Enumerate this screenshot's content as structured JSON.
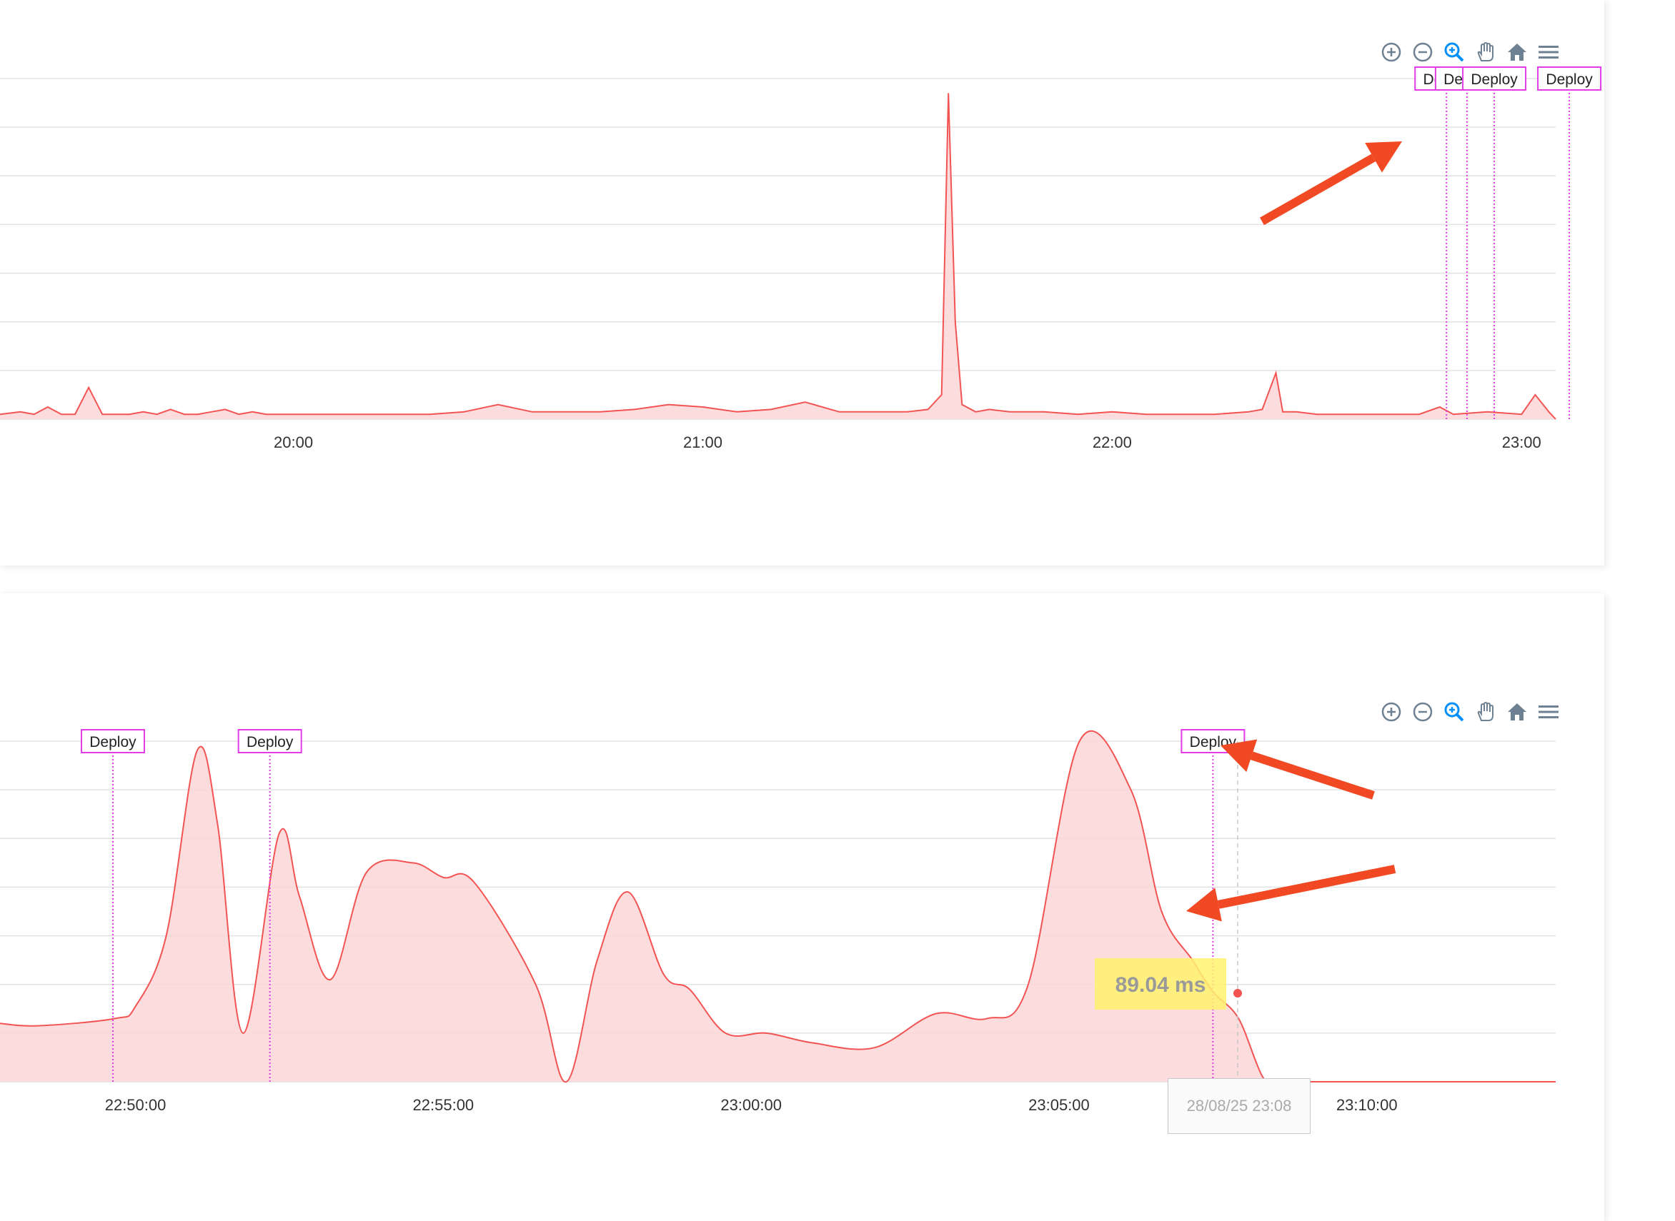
{
  "colors": {
    "series": "#f25454",
    "fill": "#fcd6d6",
    "annotation": "#e03ce8",
    "arrow": "#f04923",
    "tooltip_bg": "#fff26e",
    "grid": "#e2e2e2"
  },
  "toolbar_icons": [
    "zoom-in-icon",
    "zoom-out-icon",
    "zoom-icon",
    "pan-icon",
    "home-icon",
    "menu-icon"
  ],
  "chart_data": [
    {
      "type": "area",
      "grid": true,
      "x_ticks": [
        "20:00",
        "21:00",
        "22:00",
        "23:00"
      ],
      "xlim": [
        "19:17",
        "23:05"
      ],
      "y_labels_visible": false,
      "annotations": [
        {
          "label": "Deploy",
          "x": "22:49"
        },
        {
          "label": "Deploy",
          "x": "22:52"
        },
        {
          "label": "Deploy",
          "x": "22:56"
        },
        {
          "label": "Deploy",
          "x": "23:07"
        }
      ],
      "series": [
        {
          "x": [
            "19:17",
            "19:20",
            "19:22",
            "19:24",
            "19:26",
            "19:28",
            "19:30",
            "19:32",
            "19:34",
            "19:36",
            "19:38",
            "19:40",
            "19:42",
            "19:44",
            "19:46",
            "19:48",
            "19:50",
            "19:52",
            "19:54",
            "19:56",
            "19:58",
            "20:00",
            "20:05",
            "20:10",
            "20:15",
            "20:20",
            "20:25",
            "20:30",
            "20:35",
            "20:40",
            "20:45",
            "20:50",
            "20:55",
            "21:00",
            "21:05",
            "21:10",
            "21:15",
            "21:20",
            "21:25",
            "21:30",
            "21:33",
            "21:35",
            "21:36",
            "21:37",
            "21:38",
            "21:40",
            "21:42",
            "21:45",
            "21:50",
            "21:55",
            "22:00",
            "22:05",
            "22:10",
            "22:15",
            "22:20",
            "22:22",
            "22:24",
            "22:25",
            "22:27",
            "22:30",
            "22:35",
            "22:40",
            "22:45",
            "22:48",
            "22:50",
            "22:55",
            "23:00",
            "23:02",
            "23:04",
            "23:05"
          ],
          "y": [
            1,
            1.5,
            1,
            2.5,
            1,
            1,
            6.5,
            1,
            1,
            1,
            1.5,
            1,
            2,
            1,
            1,
            1.5,
            2,
            1,
            1.5,
            1,
            1,
            1,
            1,
            1,
            1,
            1,
            1.5,
            3,
            1.5,
            1.5,
            1.5,
            2,
            3,
            2.5,
            1.5,
            2,
            3.5,
            1.5,
            1.5,
            1.5,
            2,
            5,
            67,
            20,
            3,
            1.5,
            2,
            1.5,
            1.5,
            1,
            1.5,
            1,
            1,
            1,
            1.5,
            2,
            9.5,
            1.5,
            1.5,
            1,
            1,
            1,
            1,
            2.5,
            1,
            1.5,
            1,
            5,
            1.5,
            0
          ]
        }
      ]
    },
    {
      "type": "area",
      "grid": true,
      "x_ticks": [
        "22:50:00",
        "22:55:00",
        "23:00:00",
        "23:05:00",
        "23:10:00"
      ],
      "xlim": [
        "22:47:48",
        "23:13:04"
      ],
      "y_labels_visible": false,
      "annotations": [
        {
          "label": "Deploy",
          "x": "22:49:38"
        },
        {
          "label": "Deploy",
          "x": "22:52:11"
        },
        {
          "label": "Deploy",
          "x": "23:07:30"
        }
      ],
      "tooltip": {
        "value_label": "89.04 ms",
        "x_label": "28/08/25 23:08"
      },
      "series": [
        {
          "x": [
            "22:47:48",
            "22:48:25",
            "22:49:40",
            "22:50:00",
            "22:50:30",
            "22:51:00",
            "22:51:20",
            "22:51:45",
            "22:52:20",
            "22:52:40",
            "22:53:10",
            "22:53:45",
            "22:54:30",
            "22:55:00",
            "22:55:30",
            "22:56:30",
            "22:57:00",
            "22:57:30",
            "22:58:00",
            "22:58:35",
            "22:59:00",
            "22:59:35",
            "23:00:15",
            "23:01:00",
            "23:02:00",
            "23:03:00",
            "23:03:50",
            "23:04:30",
            "23:05:20",
            "23:06:10",
            "23:06:40",
            "23:07:10",
            "23:07:30",
            "23:07:55",
            "23:08:20",
            "23:08:40",
            "23:09:05",
            "23:09:25",
            "23:09:50",
            "23:13:04"
          ],
          "y": [
            12,
            11.5,
            13,
            15.5,
            30,
            68,
            53,
            10,
            51,
            38,
            21,
            43,
            45,
            42,
            41,
            20,
            0,
            25,
            39,
            22,
            19,
            10,
            10,
            8,
            7,
            14,
            13,
            20,
            70,
            60,
            35,
            25,
            18.5,
            13,
            0.5,
            0,
            0,
            0,
            0,
            0
          ]
        }
      ]
    }
  ]
}
